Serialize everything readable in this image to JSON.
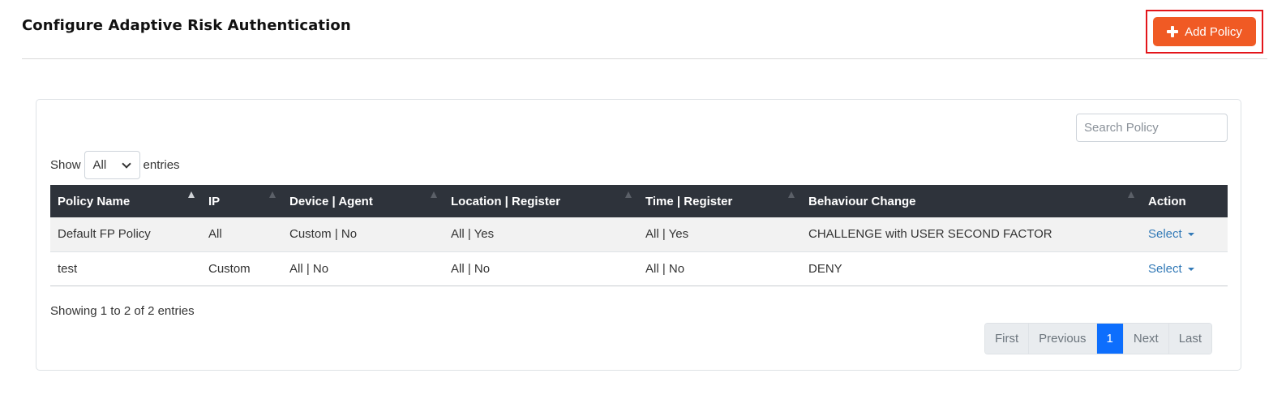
{
  "header": {
    "title": "Configure Adaptive Risk Authentication",
    "add_policy_label": "Add Policy"
  },
  "search": {
    "placeholder": "Search Policy"
  },
  "length_menu": {
    "show_label": "Show",
    "selected": "All",
    "entries_label": "entries"
  },
  "table": {
    "columns": [
      {
        "label": "Policy Name",
        "sortable": true
      },
      {
        "label": "IP",
        "sortable": true
      },
      {
        "label": "Device | Agent",
        "sortable": true
      },
      {
        "label": "Location | Register",
        "sortable": true
      },
      {
        "label": "Time | Register",
        "sortable": true
      },
      {
        "label": "Behaviour Change",
        "sortable": true
      },
      {
        "label": "Action",
        "sortable": false
      }
    ],
    "rows": [
      [
        "Default FP Policy",
        "All",
        "Custom | No",
        "All | Yes",
        "All | Yes",
        "CHALLENGE with USER SECOND FACTOR",
        "Select"
      ],
      [
        "test",
        "Custom",
        "All | No",
        "All | No",
        "All | No",
        "DENY",
        "Select"
      ]
    ]
  },
  "info": {
    "text": "Showing 1 to 2 of 2 entries"
  },
  "pagination": {
    "first": "First",
    "previous": "Previous",
    "current": "1",
    "next": "Next",
    "last": "Last"
  },
  "colors": {
    "accent": "#f05a24",
    "highlight_border": "#e3151a",
    "table_header": "#2e333b",
    "link": "#337ab7",
    "page_active": "#0d6efd"
  }
}
